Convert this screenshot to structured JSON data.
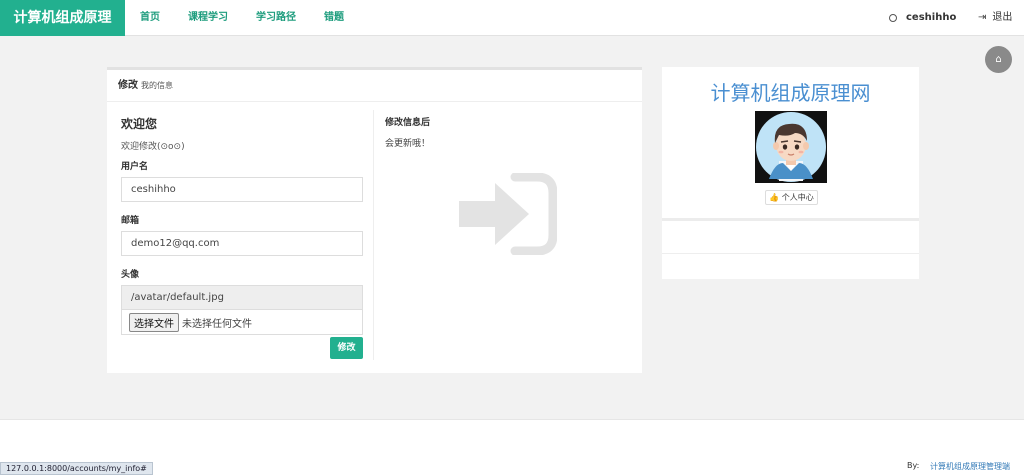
{
  "navbar": {
    "brand": "计算机组成原理",
    "links": [
      "首页",
      "课程学习",
      "学习路径",
      "错题"
    ],
    "username": "ceshihho",
    "logout": "退出"
  },
  "card": {
    "title": "修改",
    "subtitle": "我的信息",
    "welcome_heading": "欢迎您",
    "welcome_text": "欢迎修改(⊙o⊙)",
    "username_label": "用户名",
    "username_value": "ceshihho",
    "email_label": "邮箱",
    "email_value": "demo12@qq.com",
    "avatar_label": "头像",
    "avatar_path": "/avatar/default.jpg",
    "file_button": "选择文件",
    "file_status": "未选择任何文件",
    "submit": "修改",
    "after_title": "修改信息后",
    "after_text": "会更新哦！"
  },
  "side": {
    "site_title": "计算机组成原理网",
    "profile_button": "个人中心"
  },
  "footer": {
    "by": "By:",
    "link": "计算机组成原理管理端"
  },
  "status_url": "127.0.0.1:8000/accounts/my_info#",
  "colors": {
    "brand": "#22b08f",
    "link": "#1e9d7e",
    "title_blue": "#4a8fd1"
  }
}
